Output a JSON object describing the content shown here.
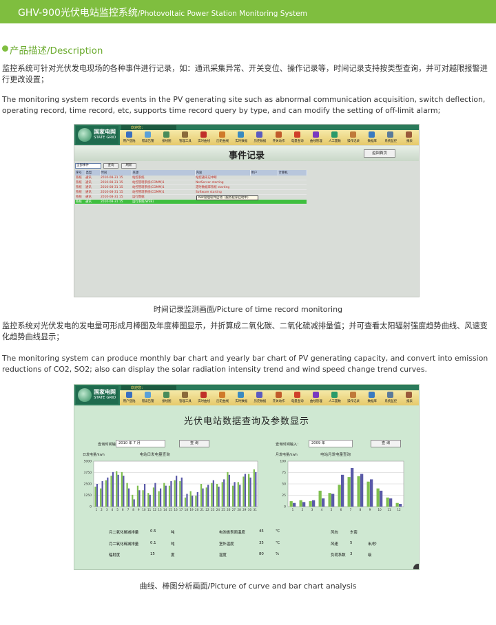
{
  "header": {
    "title_cn": "GHV-900光伏电站监控系统",
    "title_en": "/Photovoltaic Power Station Monitoring System"
  },
  "section": {
    "title": "产品描述/Description"
  },
  "paragraphs": {
    "p1_cn": "监控系统可针对光伏发电现场的各种事件进行记录，如：通讯采集异常、开关变位、操作记录等，时间记录支持按类型查询，并可对越限报警进行更改设置；",
    "p1_en": "The monitoring system records events in the PV generating site such as abnormal communication acquisition, switch deflection, operating record, time record, etc, supports time record query by type, and can modify the setting of off-limit alarm;",
    "p2_cn": "监控系统对光伏发电的发电量可形成月棒图及年度棒图显示，并折算成二氧化碳、二氧化硫减排量值；并可查看太阳辐射强度趋势曲线、风速变化趋势曲线显示；",
    "p2_en": "The monitoring system can produce monthly bar chart and yearly bar chart of PV generating capacity, and convert into emission reductions of CO2, SO2; also can display the solar radiation intensity trend and wind speed change trend curves."
  },
  "captions": {
    "fig1": "时间记录监测画面/Picture of time record monitoring",
    "fig2": "曲线、棒图分析画面/Picture of curve and bar chart analysis"
  },
  "app": {
    "logo_cn": "国家电网",
    "logo_en": "STATE GRID",
    "welcome": "欢迎您：",
    "toolbar": [
      {
        "label": "用户登陆",
        "color": "#3a6fc0"
      },
      {
        "label": "错误告警",
        "color": "#5aa0d8"
      },
      {
        "label": "接线图",
        "color": "#4a8c5a"
      },
      {
        "label": "管理工具",
        "color": "#8a6a3a"
      },
      {
        "label": "实时曲线",
        "color": "#c0302a"
      },
      {
        "label": "历史曲线",
        "color": "#d07a2a"
      },
      {
        "label": "实时数据",
        "color": "#3a8ac0"
      },
      {
        "label": "历史数据",
        "color": "#5a5ac0"
      },
      {
        "label": "开关动作",
        "color": "#c05a2a"
      },
      {
        "label": "电量查询",
        "color": "#d0402a"
      },
      {
        "label": "曲线管理",
        "color": "#7a3ac0"
      },
      {
        "label": "人工置数",
        "color": "#2a9a6a"
      },
      {
        "label": "操作记录",
        "color": "#c07a3a"
      },
      {
        "label": "数据库",
        "color": "#3a7ac0"
      },
      {
        "label": "系统监控",
        "color": "#5a7a9a"
      },
      {
        "label": "报表",
        "color": "#9a5a3a"
      }
    ]
  },
  "events": {
    "title": "事件记录",
    "back_button": "返回首页",
    "filter_select": "全部事件",
    "query_button": "查询",
    "extra_button": "刷新",
    "columns": [
      "序号",
      "类型",
      "时间",
      "来源",
      "内容",
      "用户",
      "计算机"
    ],
    "rows": [
      [
        "系统",
        "通讯",
        "2010-08-31 15",
        "站控系统",
        "站控通讯已中断",
        "",
        ""
      ],
      [
        "系统",
        "通讯",
        "2010-08-31 15",
        "站控管理系统(COMM)1",
        "NetServer starting",
        "",
        ""
      ],
      [
        "系统",
        "通讯",
        "2010-08-31 15",
        "站控管理系统(COMM)1",
        "定时数据库系统 starting",
        "",
        ""
      ],
      [
        "系统",
        "通讯",
        "2010-08-31 15",
        "站控管理系统(COMM)1",
        "Software starting",
        "",
        ""
      ],
      [
        "系统",
        "通讯",
        "2010-08-31 15",
        "运行数据",
        "",
        "",
        ""
      ],
      [
        "系统",
        "通讯",
        "2010-08-31 15",
        "运行系统(WEB)",
        "",
        "",
        ""
      ]
    ],
    "selected_row": 5,
    "tooltip": "Net管理软件启动（服务程序启动中）"
  },
  "pv": {
    "title": "光伏电站数据查询及参数显示",
    "query_label_left": "查询时间输入：",
    "query_value_left": "2010  年  7  月",
    "query_button_left": "查  询",
    "query_label_right": "查询时间输入：",
    "query_value_right": "2009  年",
    "query_button_right": "查  询",
    "stats": [
      {
        "label": "月二氧化碳减排量",
        "value": "0.5",
        "unit": "吨"
      },
      {
        "label": "月二氧化硫减排量",
        "value": "0.1",
        "unit": "吨"
      },
      {
        "label": "辐射度",
        "value": "15",
        "unit": "度"
      },
      {
        "label": "电池板表面温度",
        "value": "45",
        "unit": "℃"
      },
      {
        "label": "室外温度",
        "value": "35",
        "unit": "℃"
      },
      {
        "label": "湿度",
        "value": "80",
        "unit": "%"
      },
      {
        "label": "风向",
        "value": "东南",
        "unit": ""
      },
      {
        "label": "风速",
        "value": "5",
        "unit": "米/秒"
      },
      {
        "label": "负荷系数",
        "value": "3",
        "unit": "级"
      }
    ]
  },
  "chart_data": [
    {
      "type": "bar",
      "title": "电站日发电量查询",
      "ylabel": "日发电量/kwh",
      "categories": [
        "1",
        "2",
        "3",
        "4",
        "5",
        "6",
        "7",
        "8",
        "9",
        "10",
        "11",
        "12",
        "13",
        "14",
        "15",
        "16",
        "17",
        "18",
        "19",
        "20",
        "21",
        "22",
        "23",
        "24",
        "25",
        "26",
        "27",
        "28",
        "29",
        "30",
        "31"
      ],
      "series": [
        {
          "values": [
            2200,
            2000,
            2900,
            3400,
            3900,
            3800,
            2600,
            1300,
            2300,
            1800,
            1500,
            2100,
            1700,
            2600,
            2300,
            2900,
            2800,
            1000,
            1700,
            1200,
            2500,
            2100,
            2600,
            2500,
            2700,
            3800,
            2300,
            2700,
            3300,
            3600,
            4100
          ]
        },
        {
          "values": [
            2500,
            2800,
            3200,
            3800,
            3500,
            3400,
            2000,
            800,
            1800,
            2500,
            1300,
            2600,
            2000,
            2300,
            2800,
            3400,
            3200,
            1400,
            1200,
            1600,
            2000,
            2400,
            2900,
            2200,
            3000,
            3500,
            2700,
            2400,
            3600,
            3200,
            3800
          ]
        }
      ],
      "yticks": [
        "0",
        "1250",
        "2500",
        "3750",
        "5000"
      ],
      "ylim": [
        0,
        5000
      ],
      "colors": [
        "#7fbf4f",
        "#5a5aa8"
      ]
    },
    {
      "type": "bar",
      "title": "电站月发电量查询",
      "ylabel": "月发电量/kwh",
      "categories": [
        "1",
        "2",
        "3",
        "4",
        "5",
        "6",
        "7",
        "8",
        "9",
        "10",
        "11",
        "12"
      ],
      "series": [
        {
          "values": [
            12,
            14,
            12,
            35,
            30,
            48,
            65,
            67,
            55,
            40,
            20,
            8
          ]
        },
        {
          "values": [
            8,
            10,
            14,
            18,
            28,
            70,
            85,
            72,
            60,
            35,
            18,
            6
          ]
        }
      ],
      "yticks": [
        "0",
        "25",
        "50",
        "75",
        "100"
      ],
      "ylim": [
        0,
        100
      ],
      "colors": [
        "#7fbf4f",
        "#5a5aa8"
      ]
    }
  ]
}
